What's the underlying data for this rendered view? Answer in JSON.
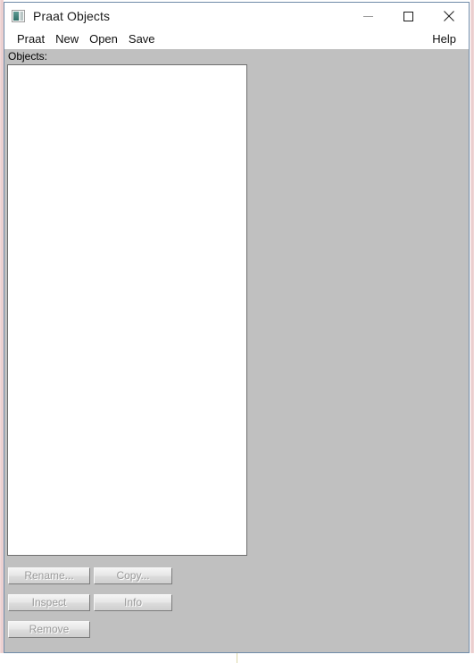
{
  "window": {
    "title": "Praat Objects",
    "icon": "praat-app-icon",
    "controls": {
      "minimize": "minimize-icon",
      "maximize": "maximize-icon",
      "close": "close-icon"
    }
  },
  "menubar": {
    "items": [
      {
        "label": "Praat"
      },
      {
        "label": "New"
      },
      {
        "label": "Open"
      },
      {
        "label": "Save"
      }
    ],
    "help": {
      "label": "Help"
    }
  },
  "client": {
    "objects_label": "Objects:",
    "objects_list": {
      "items": [],
      "empty_text": ""
    }
  },
  "buttons": {
    "rows": [
      [
        {
          "label": "Rename...",
          "enabled": false,
          "name": "rename-button"
        },
        {
          "label": "Copy...",
          "enabled": false,
          "name": "copy-button"
        }
      ],
      [
        {
          "label": "Inspect",
          "enabled": false,
          "name": "inspect-button"
        },
        {
          "label": "Info",
          "enabled": false,
          "name": "info-button"
        }
      ],
      [
        {
          "label": "Remove",
          "enabled": false,
          "name": "remove-button"
        }
      ]
    ]
  },
  "colors": {
    "client_background": "#c0c0c0",
    "titlebar_background": "#ffffff",
    "window_border": "#6f8aa8",
    "list_background": "#ffffff",
    "list_border": "#6e6e6e",
    "disabled_text": "#9b9b9b",
    "text": "#101010"
  }
}
